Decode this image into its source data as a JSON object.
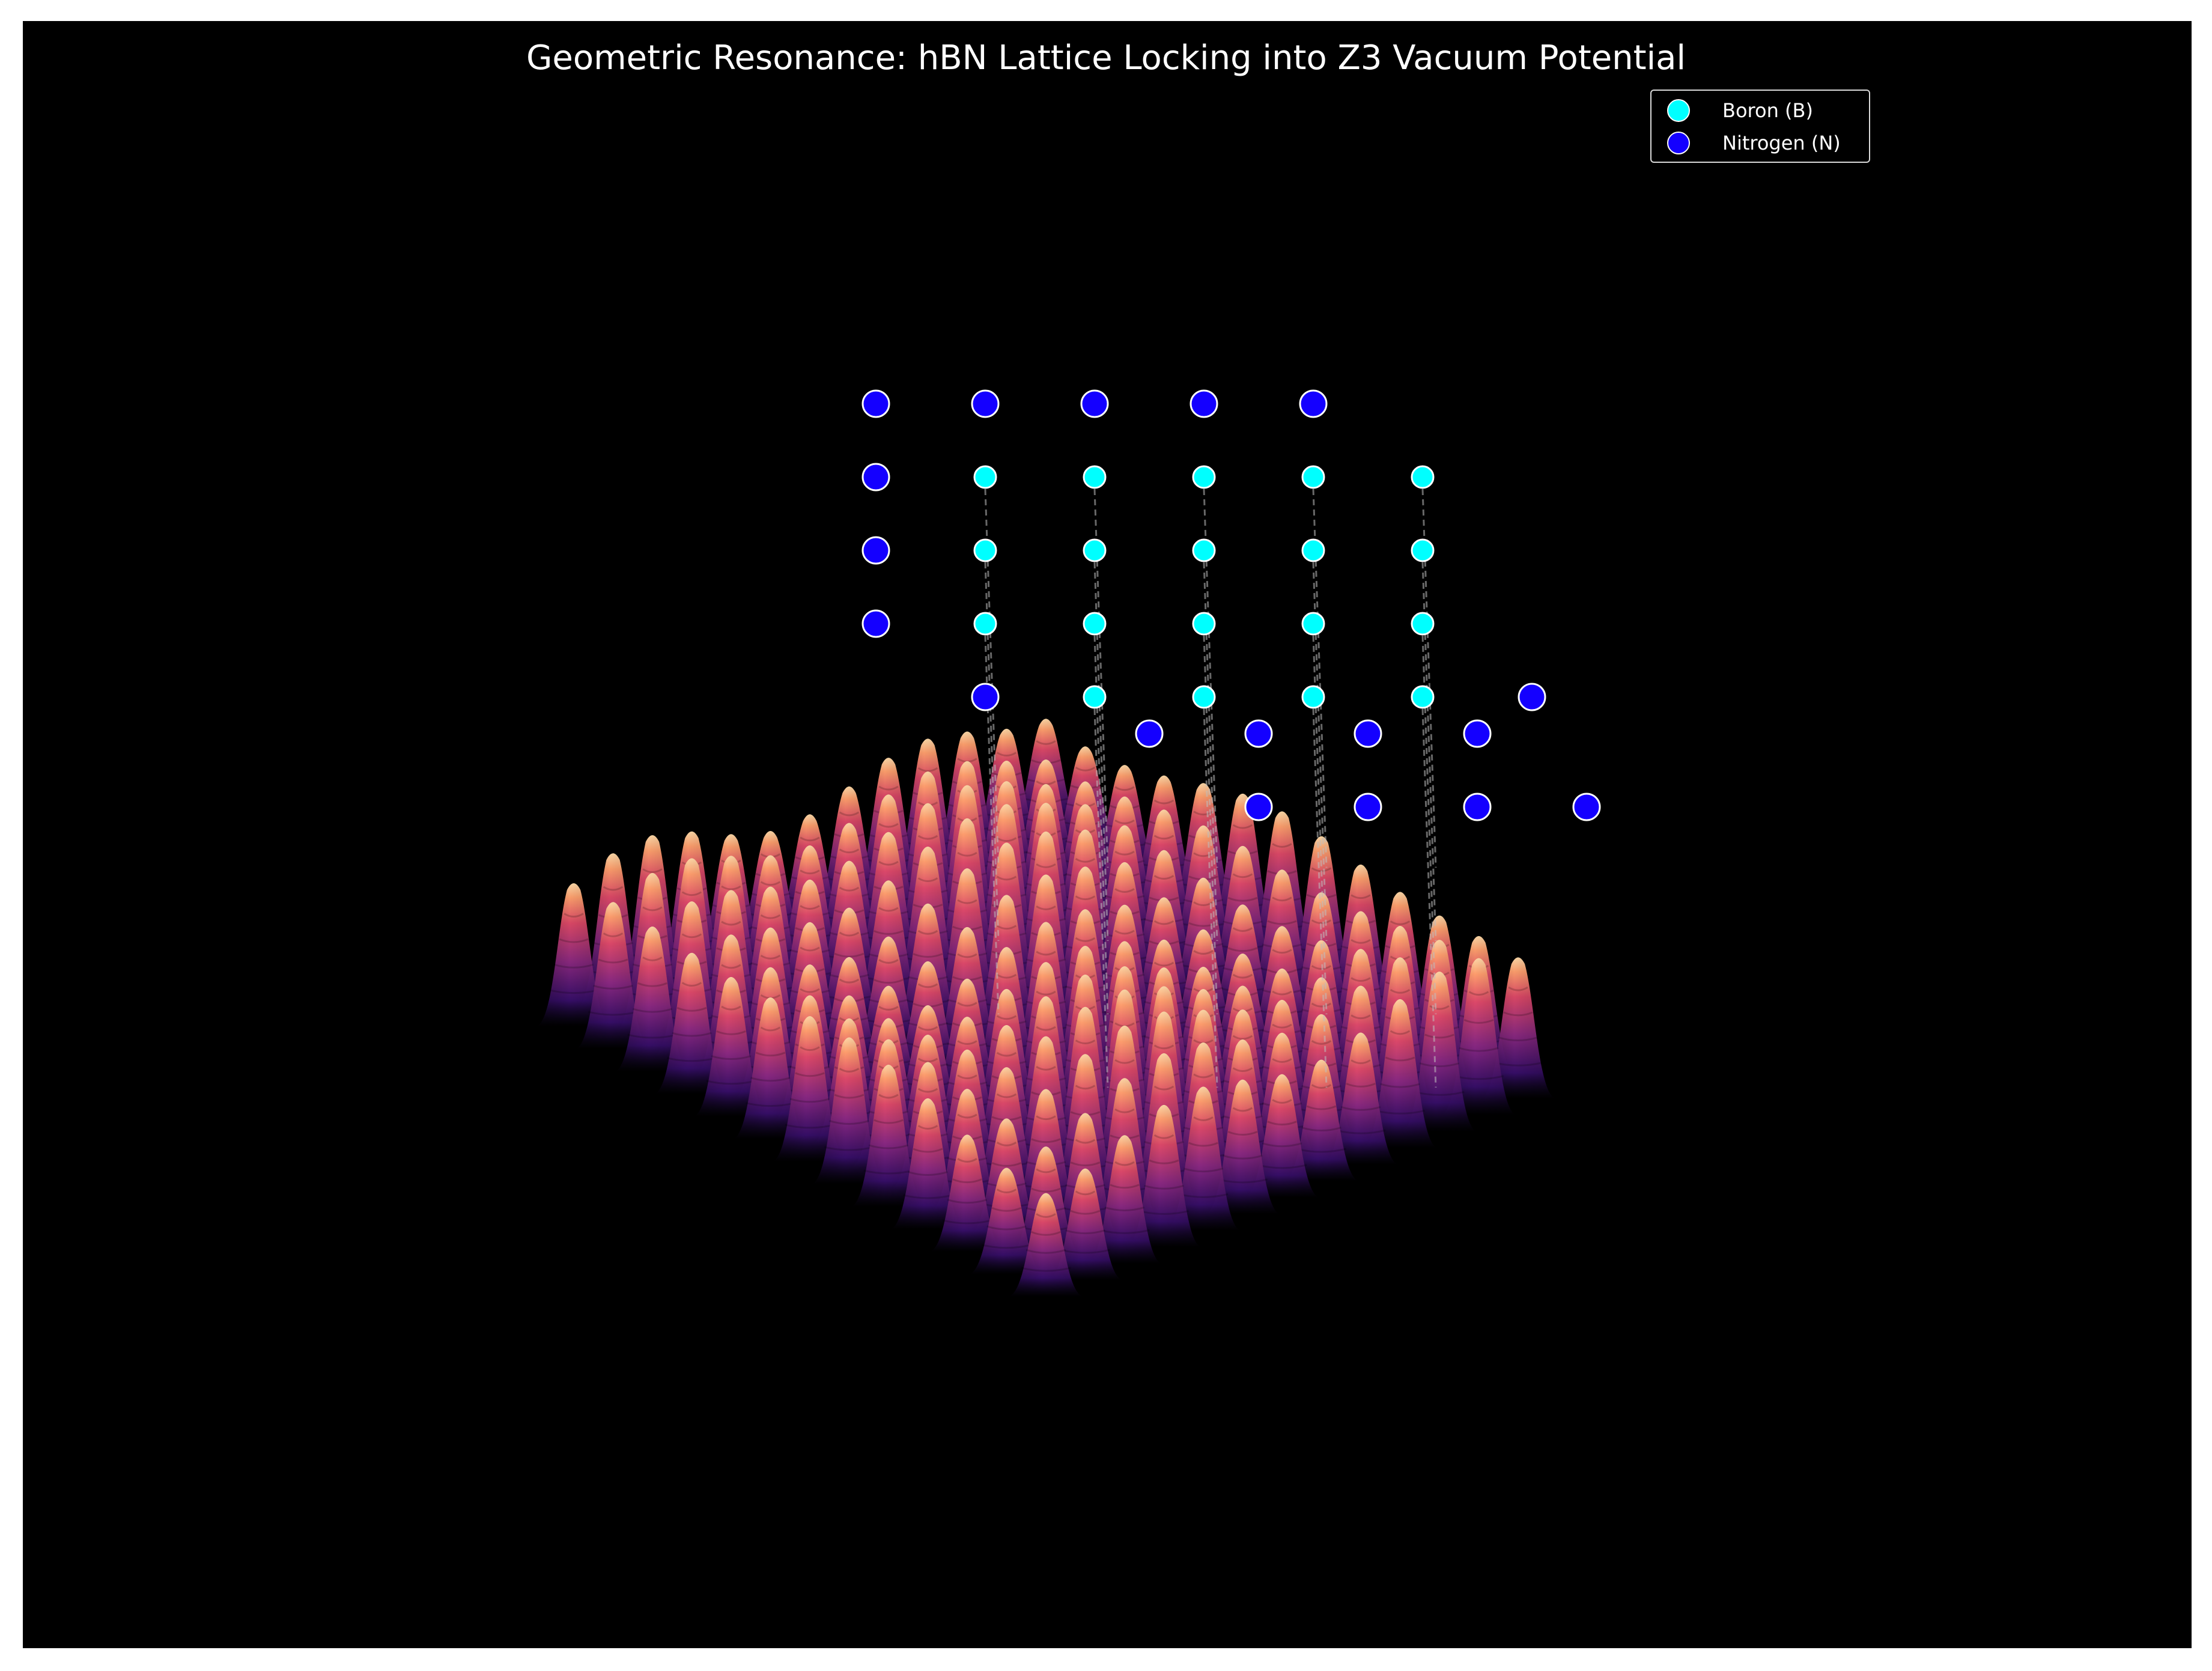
{
  "chart_data": {
    "type": "surface3d",
    "title": "Geometric Resonance: hBN Lattice Locking into Z3 Vacuum Potential",
    "xlabel": "",
    "ylabel": "",
    "zlabel": "",
    "axes_visible": false,
    "background_color": "#000000",
    "surface": {
      "colormap": "magma",
      "peak_rows": 13,
      "peak_cols": 13
    },
    "series": [
      {
        "name": "Boron (B)",
        "color": "#00ffff",
        "marker": "circle",
        "points": [
          [
            2,
            4
          ],
          [
            2,
            6
          ],
          [
            3,
            3
          ],
          [
            3,
            5
          ],
          [
            3,
            7
          ],
          [
            4,
            2
          ],
          [
            4,
            4
          ],
          [
            4,
            6
          ],
          [
            4,
            8
          ],
          [
            5,
            3
          ],
          [
            5,
            5
          ],
          [
            5,
            7
          ],
          [
            5,
            9
          ],
          [
            6,
            4
          ],
          [
            6,
            6
          ],
          [
            6,
            8
          ],
          [
            7,
            5
          ],
          [
            7,
            7
          ],
          [
            8,
            6
          ]
        ]
      },
      {
        "name": "Nitrogen (N)",
        "color": "#1400ff",
        "marker": "circle",
        "points": [
          [
            1,
            3
          ],
          [
            1,
            5
          ],
          [
            2,
            2
          ],
          [
            2,
            7
          ],
          [
            2,
            9
          ],
          [
            3,
            1
          ],
          [
            3,
            8
          ],
          [
            3,
            10
          ],
          [
            4,
            0
          ],
          [
            4,
            9
          ],
          [
            4,
            11
          ],
          [
            5,
            1
          ],
          [
            5,
            10
          ],
          [
            5,
            12
          ],
          [
            6,
            2
          ],
          [
            6,
            10
          ],
          [
            7,
            3
          ],
          [
            8,
            4
          ]
        ]
      }
    ],
    "drop_lines": true,
    "legend": {
      "position": "top-right",
      "entries": [
        "Boron (B)",
        "Nitrogen (N)"
      ]
    }
  }
}
